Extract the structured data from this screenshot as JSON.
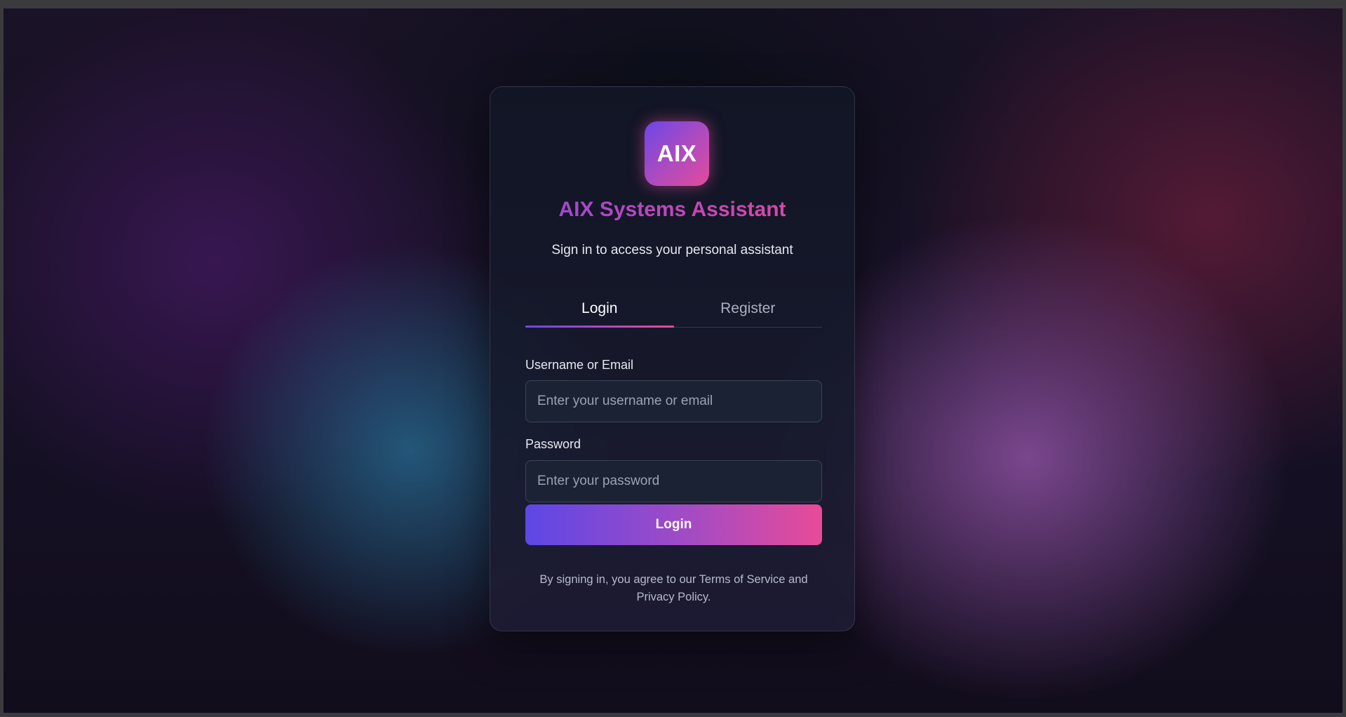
{
  "logo": {
    "text": "AIX"
  },
  "header": {
    "title": "AIX Systems Assistant",
    "subtitle": "Sign in to access your personal assistant"
  },
  "tabs": [
    {
      "label": "Login",
      "active": true
    },
    {
      "label": "Register",
      "active": false
    }
  ],
  "form": {
    "username": {
      "label": "Username or Email",
      "placeholder": "Enter your username or email",
      "value": ""
    },
    "password": {
      "label": "Password",
      "placeholder": "Enter your password",
      "value": ""
    },
    "submit_label": "Login"
  },
  "footer": {
    "terms_line1": "By signing in, you agree to our Terms of Service and",
    "terms_line2": "Privacy Policy."
  },
  "colors": {
    "accent_start": "#5d47e6",
    "accent_end": "#e84b98",
    "card_bg": "#141a2c"
  }
}
